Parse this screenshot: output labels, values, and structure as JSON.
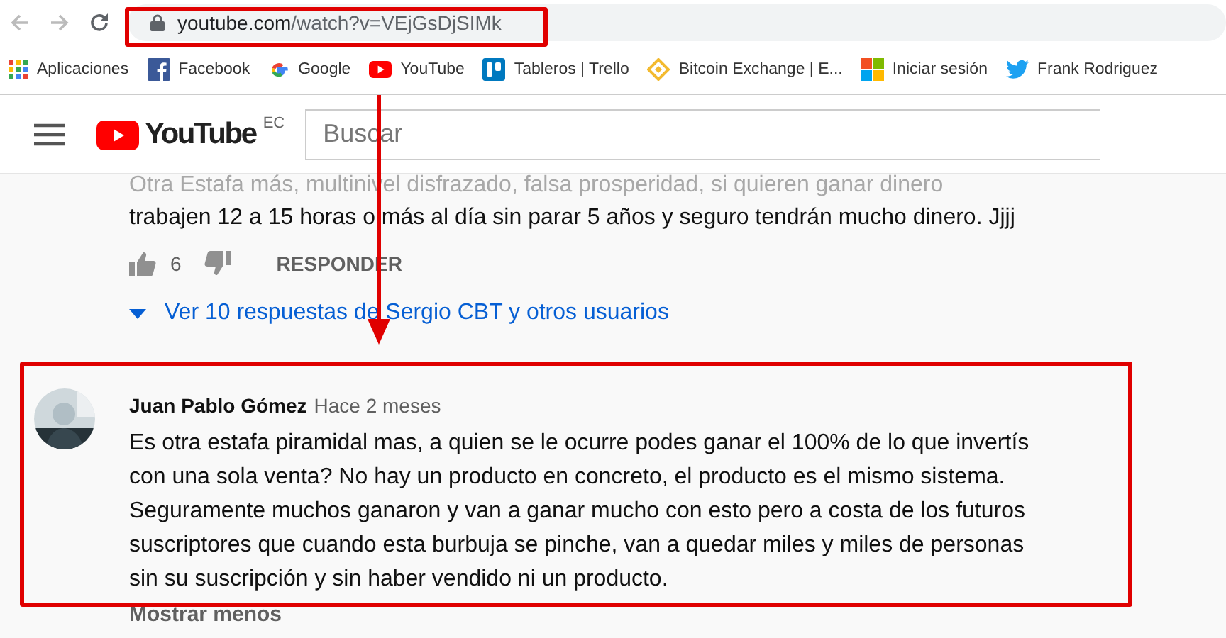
{
  "browser": {
    "url_host": "youtube.com",
    "url_path": "/watch?v=VEjGsDjSIMk",
    "secure": true,
    "bookmarks": [
      {
        "label": "Aplicaciones",
        "kind": "apps"
      },
      {
        "label": "Facebook",
        "kind": "facebook"
      },
      {
        "label": "Google",
        "kind": "google"
      },
      {
        "label": "YouTube",
        "kind": "youtube"
      },
      {
        "label": "Tableros | Trello",
        "kind": "trello"
      },
      {
        "label": "Bitcoin Exchange | E...",
        "kind": "diamond"
      },
      {
        "label": "Iniciar sesión",
        "kind": "windows"
      },
      {
        "label": "Frank Rodriguez",
        "kind": "bird"
      }
    ]
  },
  "header": {
    "logo": "YouTube",
    "region": "EC",
    "search": {
      "placeholder": "Buscar"
    }
  },
  "previous_comment": {
    "faded_line": "Otra Estafa más, multinivel disfrazado, falsa prosperidad, si quieren ganar dinero",
    "text": "trabajen 12 a 15 horas o más al día sin parar 5 años y seguro tendrán mucho dinero. Jjjj",
    "likes": "6",
    "reply": "RESPONDER",
    "replies_link": "Ver 10 respuestas de Sergio CBT y otros usuarios"
  },
  "comment": {
    "author": "Juan Pablo Gómez",
    "time": "Hace 2 meses",
    "text": "Es otra estafa piramidal mas, a quien se le ocurre podes ganar el 100% de lo que invertís con una sola venta? No hay un producto en concreto, el producto es el mismo sistema. Seguramente muchos ganaron y van a ganar mucho con esto pero a costa de los futuros suscriptores que cuando esta burbuja se pinche, van a quedar miles y miles de personas sin su suscripción y sin haber vendido ni un producto.",
    "toggle": "Mostrar menos"
  },
  "annotations": {
    "highlight_url": true,
    "highlight_comment": true,
    "arrow": true
  }
}
